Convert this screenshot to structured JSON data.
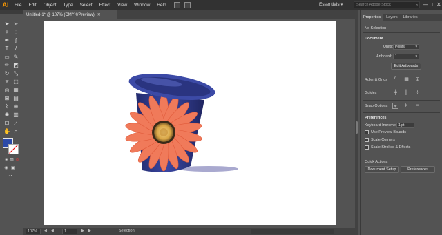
{
  "app": {
    "logo": "Ai"
  },
  "menu": [
    "File",
    "Edit",
    "Object",
    "Type",
    "Select",
    "Effect",
    "View",
    "Window",
    "Help"
  ],
  "workspace": {
    "label": "Essentials",
    "caret": "▾"
  },
  "search": {
    "placeholder": "Search Adobe Stock"
  },
  "window_controls": {
    "minimize": "—",
    "maximize": "□",
    "close": "✕"
  },
  "document_tab": {
    "title": "Untitled-1* @ 107% (CMYK/Preview)",
    "close": "✕"
  },
  "status": {
    "zoom": "107%",
    "page": "1",
    "text": "Selection",
    "prev": "◀",
    "next": "▶"
  },
  "properties": {
    "tabs": [
      "Properties",
      "Layers",
      "Libraries"
    ],
    "no_selection": "No Selection",
    "document_header": "Document",
    "units_label": "Units:",
    "units_value": "Points",
    "artboard_label": "Artboard:",
    "artboard_value": "1",
    "edit_artboards": "Edit Artboards",
    "ruler_grids": "Ruler & Grids",
    "guides": "Guides",
    "snap_options": "Snap Options",
    "preferences_header": "Preferences",
    "keyboard_increment_label": "Keyboard Increment:",
    "keyboard_increment_value": "1 pt",
    "use_preview_bounds": "Use Preview Bounds",
    "scale_corners": "Scale Corners",
    "scale_strokes": "Scale Strokes & Effects",
    "quick_actions": "Quick Actions",
    "document_setup": "Document Setup",
    "preferences_btn": "Preferences"
  },
  "colors": {
    "cup_blue": "#2e3a8c",
    "petal": "#f07a5a",
    "center": "#d9a545",
    "ui_dark": "#323232",
    "ui_mid": "#535353",
    "accent": "#ff9a00"
  }
}
